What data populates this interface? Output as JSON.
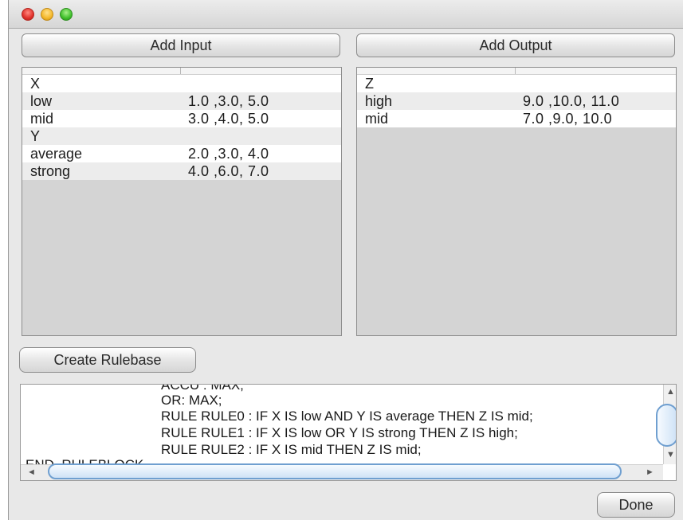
{
  "window": {
    "controls": [
      {
        "name": "close",
        "color": "#e0302a"
      },
      {
        "name": "minimize",
        "color": "#f4b82b"
      },
      {
        "name": "maximize",
        "color": "#3fbf2a"
      }
    ]
  },
  "buttons": {
    "add_input": "Add Input",
    "add_output": "Add Output",
    "create_rulebase": "Create Rulebase",
    "done": "Done"
  },
  "inputs_table": {
    "rows": [
      {
        "name": "X",
        "values": ""
      },
      {
        "name": "low",
        "values": "1.0 ,3.0, 5.0"
      },
      {
        "name": "mid",
        "values": "3.0 ,4.0, 5.0"
      },
      {
        "name": "Y",
        "values": ""
      },
      {
        "name": "average",
        "values": "2.0 ,3.0, 4.0"
      },
      {
        "name": "strong",
        "values": "4.0 ,6.0, 7.0"
      }
    ]
  },
  "outputs_table": {
    "rows": [
      {
        "name": "Z",
        "values": ""
      },
      {
        "name": "high",
        "values": "9.0 ,10.0, 11.0"
      },
      {
        "name": "mid",
        "values": "7.0 ,9.0, 10.0"
      }
    ]
  },
  "rulebase_text": {
    "lines": [
      "ACCU : MAX;",
      "OR: MAX;",
      "RULE RULE0 : IF X IS low AND Y IS average THEN Z IS mid;",
      "RULE RULE1 : IF X IS low OR Y IS strong THEN Z IS high;",
      "RULE RULE2 : IF X IS mid THEN Z IS mid;",
      "END_RULEBLOCK"
    ]
  }
}
